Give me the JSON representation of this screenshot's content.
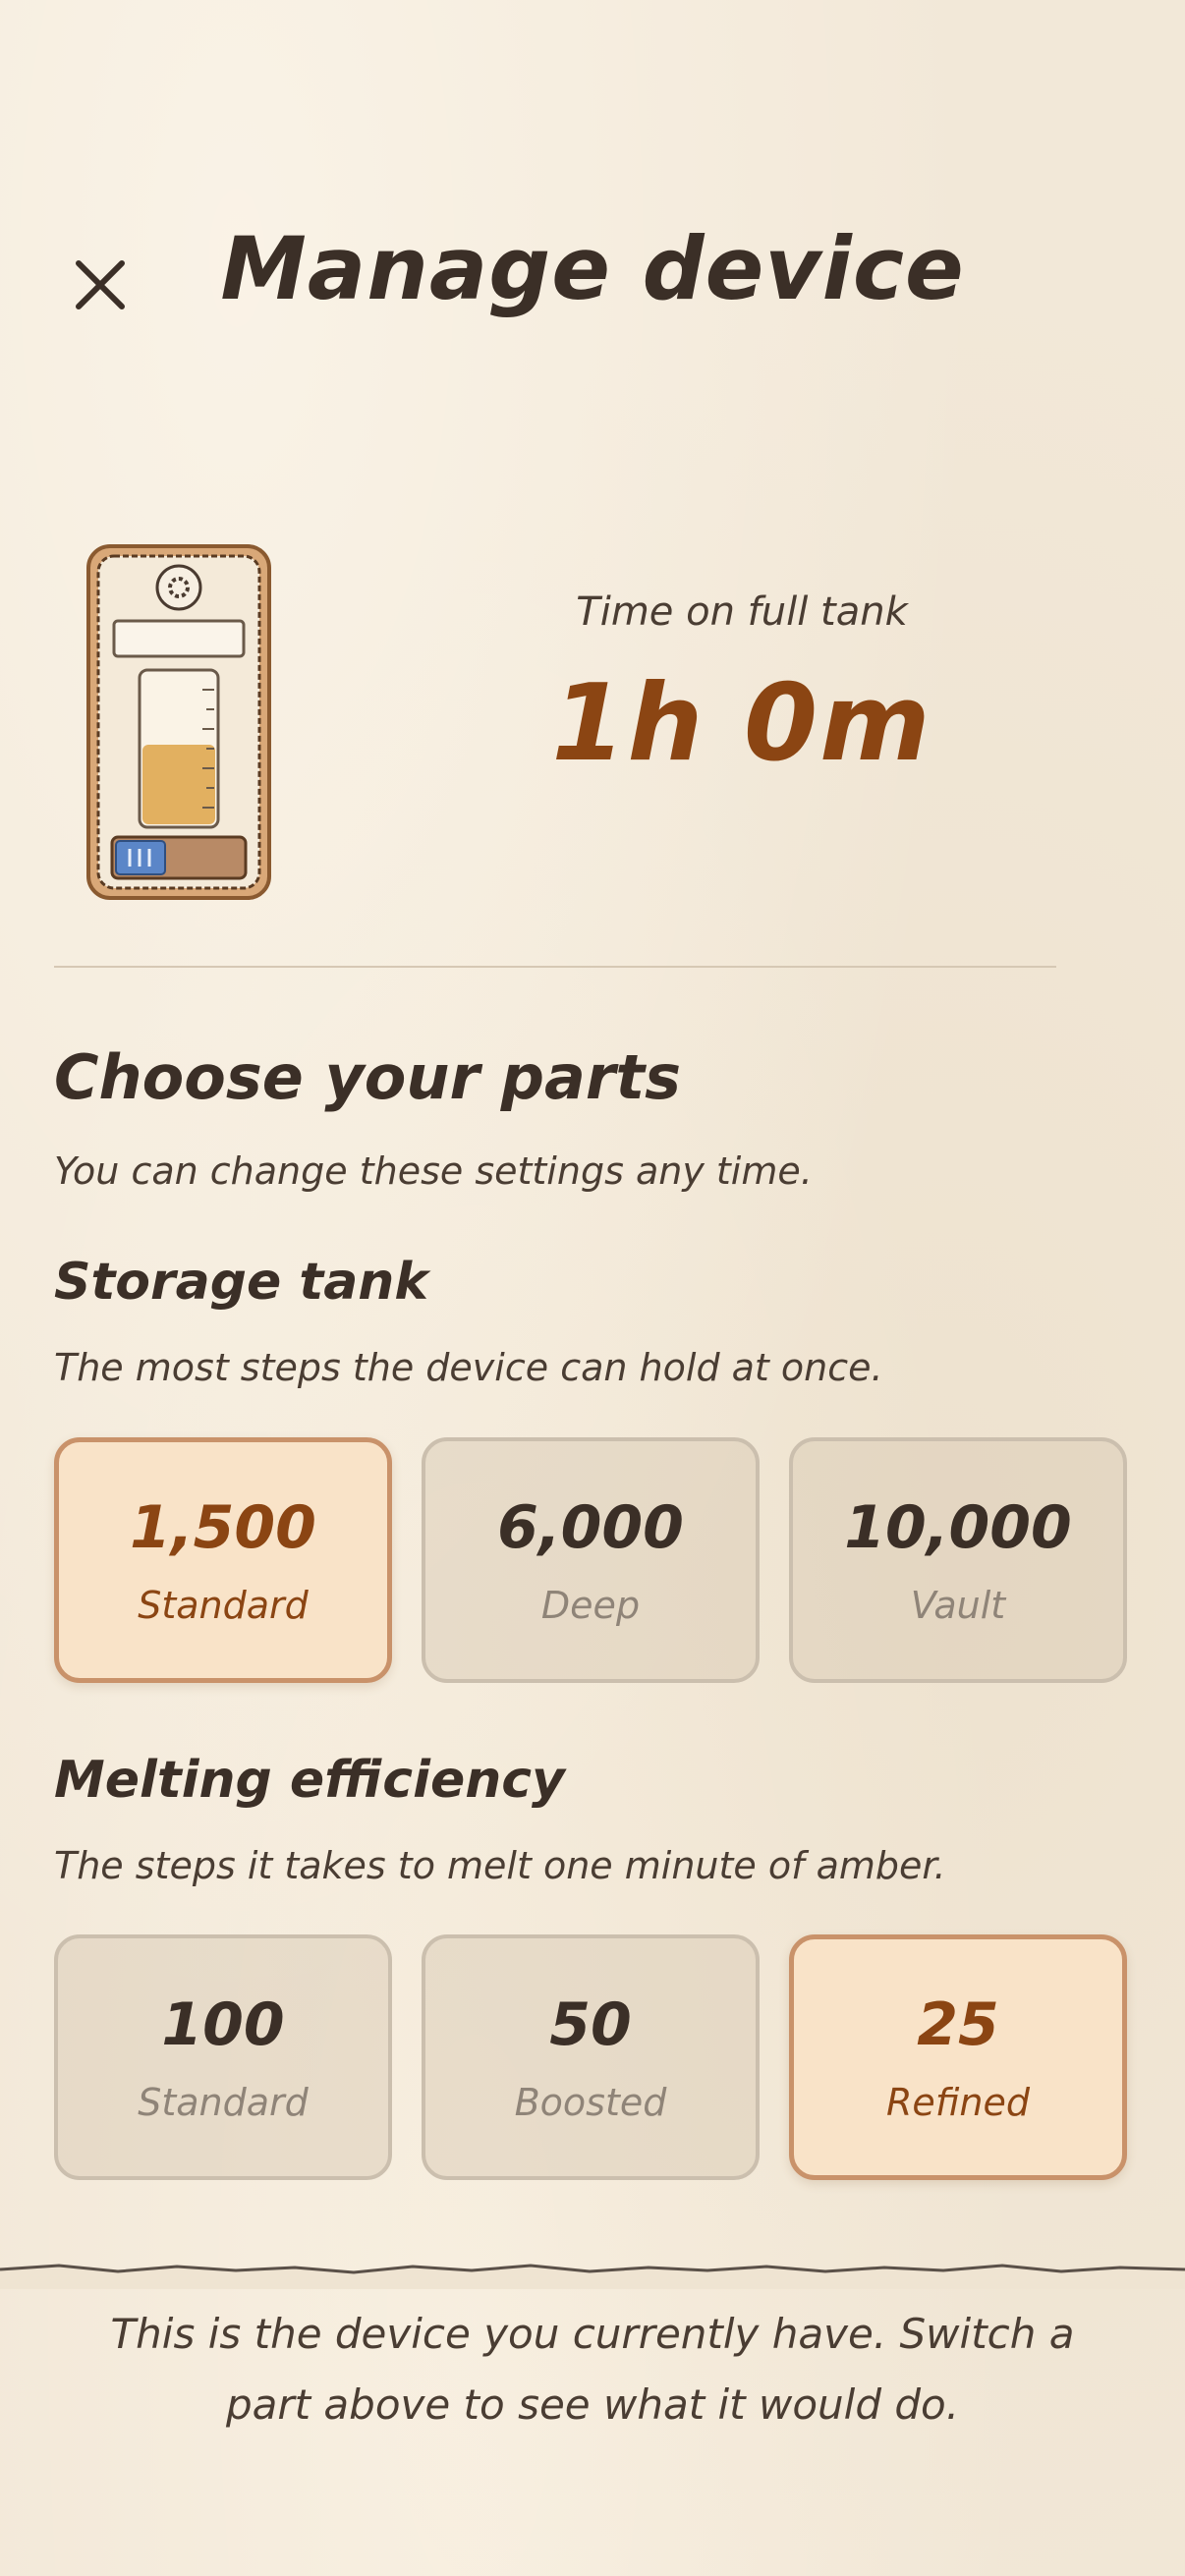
{
  "header": {
    "title": "Manage device",
    "close_icon": "close-icon"
  },
  "device": {
    "illustration_icon": "amber-device-illustration",
    "tank_label": "Time on full tank",
    "tank_value": "1h 0m"
  },
  "parts": {
    "title": "Choose your parts",
    "description": "You can change these settings any time.",
    "storage": {
      "title": "Storage tank",
      "description": "The most steps the device can hold at once.",
      "options": [
        {
          "value": "1,500",
          "label": "Standard",
          "selected": true
        },
        {
          "value": "6,000",
          "label": "Deep",
          "selected": false
        },
        {
          "value": "10,000",
          "label": "Vault",
          "selected": false
        }
      ]
    },
    "efficiency": {
      "title": "Melting efficiency",
      "description": "The steps it takes to melt one minute of amber.",
      "options": [
        {
          "value": "100",
          "label": "Standard",
          "selected": false
        },
        {
          "value": "50",
          "label": "Boosted",
          "selected": false
        },
        {
          "value": "25",
          "label": "Refined",
          "selected": true
        }
      ]
    }
  },
  "footer": {
    "note": "This is the device you currently have. Switch a part above to see what it would do."
  },
  "colors": {
    "background": "#f2e8d8",
    "accent": "#8b4513",
    "selected_fill": "#f9e3c8",
    "selected_border": "#c9926a",
    "text": "#3b2f27"
  }
}
